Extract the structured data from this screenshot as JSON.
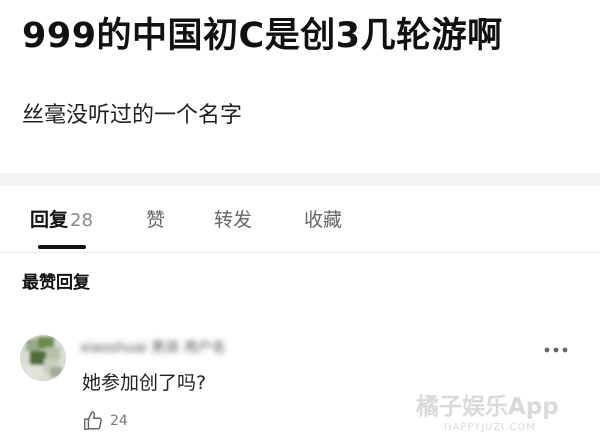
{
  "post": {
    "title": "999的中国初C是创3几轮游啊",
    "body": "丝毫没听过的一个名字"
  },
  "tabs": [
    {
      "label": "回复",
      "count": "28",
      "active": true
    },
    {
      "label": "赞",
      "active": false
    },
    {
      "label": "转发",
      "active": false
    },
    {
      "label": "收藏",
      "active": false
    }
  ],
  "section_heading": "最赞回复",
  "comment": {
    "author": "xiaoshuai 男孩 用户名",
    "text": "她参加创了吗?",
    "likes": "24",
    "more_icon": "more-horizontal-icon",
    "like_icon": "thumbs-up-icon"
  },
  "watermark": {
    "text": "橘子娱乐App",
    "sub": "HAPPYJUZI.COM"
  },
  "colors": {
    "text_primary": "#111111",
    "text_secondary": "#666666",
    "divider_band": "#f4f4f4",
    "tab_indicator": "#111111"
  }
}
